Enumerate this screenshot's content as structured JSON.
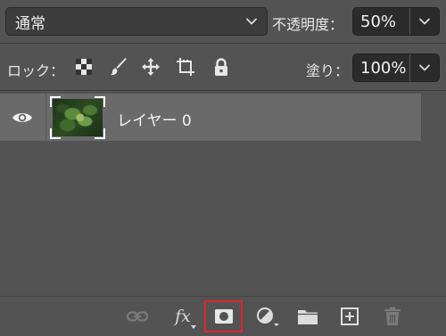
{
  "blend_mode": {
    "value": "通常"
  },
  "opacity": {
    "label": "不透明度：",
    "value": "50%"
  },
  "lock": {
    "label": "ロック："
  },
  "fill": {
    "label": "塗り：",
    "value": "100%"
  },
  "layers": [
    {
      "name": "レイヤー 0",
      "visible": true
    }
  ],
  "toolbar_icons": [
    "link-icon",
    "fx-icon",
    "add-mask-icon",
    "adjustment-icon",
    "folder-icon",
    "new-layer-icon",
    "trash-icon"
  ],
  "toolbar": {
    "fx_label": "fx"
  },
  "colors": {
    "highlight": "#e0262b",
    "panel_bg": "#535353",
    "selected_row": "#6a6a6a"
  }
}
